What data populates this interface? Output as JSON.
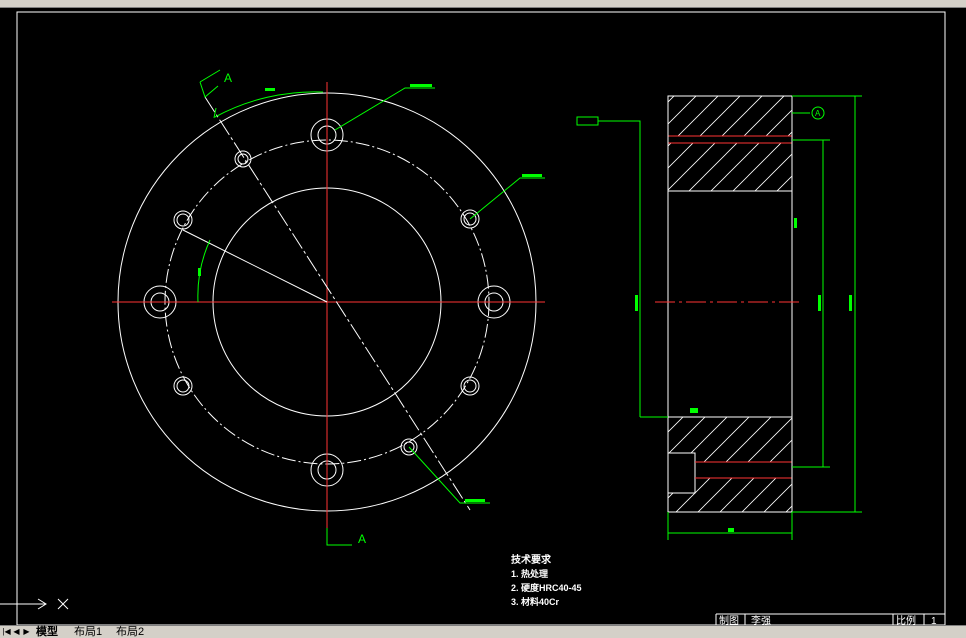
{
  "app": {
    "tabs": [
      {
        "label": "模型",
        "active": true
      },
      {
        "label": "布局1",
        "active": false
      },
      {
        "label": "布局2",
        "active": false
      }
    ]
  },
  "drawing": {
    "section_marks": [
      "A",
      "A"
    ],
    "datum_symbol": "A",
    "tech_requirements": {
      "title": "技术要求",
      "items": [
        "1. 热处理",
        "2. 硬度HRC40-45",
        "3. 材料40Cr"
      ]
    },
    "title_block": {
      "drawn_label": "制图",
      "drawn_value": "李强",
      "scale_label": "比例",
      "scale_value": "1"
    }
  },
  "colors": {
    "background": "#000000",
    "geometry": "#ffffff",
    "centerline": "#ff3333",
    "dimension": "#00ff00",
    "ui_chrome": "#d4d0c8"
  }
}
